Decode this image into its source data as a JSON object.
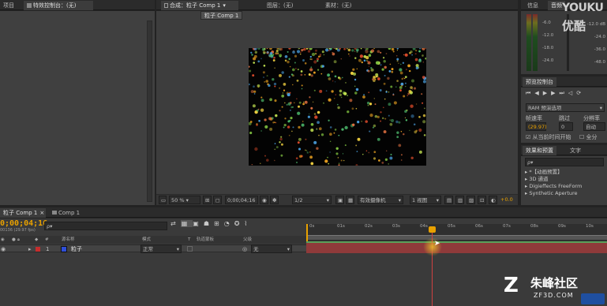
{
  "left_panel": {
    "tab_project": "项目",
    "tab_effect_controls": "特效控制台：(无)"
  },
  "comp_panel": {
    "tab_comp": "合成：粒子 Comp 1",
    "tab_layer": "图层：(无)",
    "tab_footage": "素材：(无)",
    "breadcrumb": "粒子 Comp 1",
    "zoom": "50 %",
    "timecode": "0;00;04;16",
    "resolution": "1/2",
    "camera": "有效摄像机",
    "views": "1 视图",
    "exposure": "+0.0"
  },
  "info_audio": {
    "tab_info": "信息",
    "tab_audio": "音频",
    "db_labels": [
      "0.0",
      "-6.0",
      "-12.0",
      "-18.0",
      "-24.0"
    ],
    "db_labels_right": [
      "-12.0 dB",
      "-24.0",
      "-36.0",
      "-48.0",
      "-60.0"
    ]
  },
  "preview": {
    "title": "预览控制台",
    "ram_preview": "RAM 预演选项",
    "frame_rate_label": "帧速率",
    "skip_label": "跳过",
    "resolution_label": "分辨率",
    "frame_rate": "(29.97)",
    "skip": "0",
    "resolution": "自动",
    "from_current": "从当前时间开始",
    "full_screen": "全分"
  },
  "effects": {
    "tab_effects": "效果和预置",
    "tab_text": "文字",
    "search_placeholder": "ρ▾",
    "items": [
      "*【动画预置】",
      "3D 通道",
      "Digieffects FreeForm",
      "Synthetic Aperture"
    ]
  },
  "timeline": {
    "tab_render": "渲染队列",
    "tab_comp": "粒子 Comp 1",
    "tab_comp2": "Comp 1",
    "timecode": "0;00;04;16",
    "frames": "00136 (29.97 fps)",
    "search_placeholder": "ρ▾",
    "col_num": "#",
    "col_source": "源名称",
    "col_mode": "模式",
    "col_t": "T",
    "col_trkmat": "轨道蒙板",
    "col_parent": "父级",
    "ruler": [
      "0s",
      "01s",
      "02s",
      "03s",
      "04s",
      "05s",
      "06s",
      "07s",
      "08s",
      "09s",
      "10s"
    ],
    "layer": {
      "num": "1",
      "name": "粒子",
      "mode": "正常",
      "parent": "无"
    }
  },
  "watermark": {
    "youku": "YOUKU",
    "youku_sub": "优酷",
    "zf3d": "朱峰社区",
    "zf3d_url": "ZF3D.COM"
  },
  "colors": {
    "accent": "#e8a100",
    "layer_label": "#c62d2d",
    "playhead": "#d04040"
  }
}
